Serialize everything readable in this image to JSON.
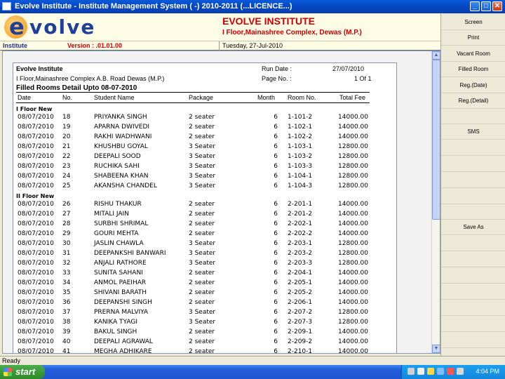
{
  "window": {
    "title": "Evolve Institute - Institute Management System ( -) 2010-2011 (...LICENCE...)"
  },
  "header": {
    "logo_text": "volve",
    "logo_letter": "e",
    "institute_name": "EVOLVE INSTITUTE",
    "institute_address": "I Floor,Mainashree Complex, Dewas (M.P.)"
  },
  "infobar": {
    "label": "Institute",
    "version": "Version : .01.01.00",
    "date": "Tuesday, 27-Jul-2010"
  },
  "right_menu": [
    "Screen",
    "Print",
    "Vacant Room",
    "Filled Room",
    "Reg.(Date)",
    "Reg.(Detail)",
    "SMS",
    "Save As"
  ],
  "report": {
    "org": "Evolve Institute",
    "address": "I Floor,Mainashree Complex A.B. Road Dewas (M.P.)",
    "title": "Filled Rooms Detail Upto 08-07-2010",
    "run_date_label": "Run Date :",
    "run_date": "27/07/2010",
    "page_label": "Page No. :",
    "page_value": "1 Of 1",
    "columns": [
      "Date",
      "No.",
      "Student Name",
      "Package",
      "Month",
      "Room No.",
      "Total Fee"
    ],
    "sections": [
      {
        "name": "I Floor New",
        "rows": [
          [
            "08/07/2010",
            "18",
            "PRIYANKA SINGH",
            "2 seater",
            "6",
            "1-101-2",
            "14000.00"
          ],
          [
            "08/07/2010",
            "19",
            "APARNA  DWIVEDI",
            "2 seater",
            "6",
            "1-102-1",
            "14000.00"
          ],
          [
            "08/07/2010",
            "20",
            "RAKHI WADHWANI",
            "2 seater",
            "6",
            "1-102-2",
            "14000.00"
          ],
          [
            "08/07/2010",
            "21",
            "KHUSHBU  GOYAL",
            "3 Seater",
            "6",
            "1-103-1",
            "12800.00"
          ],
          [
            "08/07/2010",
            "22",
            "DEEPALI  SOOD",
            "3 Seater",
            "6",
            "1-103-2",
            "12800.00"
          ],
          [
            "08/07/2010",
            "23",
            "RUCHIKA  SAHI",
            "3 Seater",
            "6",
            "1-103-3",
            "12800.00"
          ],
          [
            "08/07/2010",
            "24",
            "SHABEENA KHAN",
            "3 Seater",
            "6",
            "1-104-1",
            "12800.00"
          ],
          [
            "08/07/2010",
            "25",
            "AKANSHA CHANDEL",
            "3 Seater",
            "6",
            "1-104-3",
            "12800.00"
          ]
        ]
      },
      {
        "name": "II Floor New",
        "rows": [
          [
            "08/07/2010",
            "26",
            "RISHU  THAKUR",
            "2 seater",
            "6",
            "2-201-1",
            "14000.00"
          ],
          [
            "08/07/2010",
            "27",
            "MITALI  JAIN",
            "2 seater",
            "6",
            "2-201-2",
            "14000.00"
          ],
          [
            "08/07/2010",
            "28",
            "SURBHI  SHRIMAL",
            "2 seater",
            "6",
            "2-202-1",
            "14000.00"
          ],
          [
            "08/07/2010",
            "29",
            "GOURI  MEHTA",
            "2 seater",
            "6",
            "2-202-2",
            "14000.00"
          ],
          [
            "08/07/2010",
            "30",
            "JASLIN  CHAWLA",
            "3 Seater",
            "6",
            "2-203-1",
            "12800.00"
          ],
          [
            "08/07/2010",
            "31",
            "DEEPANKSHI  BANWARI",
            "3 Seater",
            "6",
            "2-203-2",
            "12800.00"
          ],
          [
            "08/07/2010",
            "32",
            "ANJALI  RATHORE",
            "3 Seater",
            "6",
            "2-203-3",
            "12800.00"
          ],
          [
            "08/07/2010",
            "33",
            "SUNITA  SAHANI",
            "2 seater",
            "6",
            "2-204-1",
            "14000.00"
          ],
          [
            "08/07/2010",
            "34",
            "ANMOL  PAEIHAR",
            "2 seater",
            "6",
            "2-205-1",
            "14000.00"
          ],
          [
            "08/07/2010",
            "35",
            "SHIVANI  BARATH",
            "2 seater",
            "6",
            "2-205-2",
            "14000.00"
          ],
          [
            "08/07/2010",
            "36",
            "DEEPANSHI  SINGH",
            "2 seater",
            "6",
            "2-206-1",
            "14000.00"
          ],
          [
            "08/07/2010",
            "37",
            "PRERNA  MALVIYA",
            "3 Seater",
            "6",
            "2-207-2",
            "12800.00"
          ],
          [
            "08/07/2010",
            "38",
            "KANIKA  TYAGI",
            "3 Seater",
            "6",
            "2-207-3",
            "12800.00"
          ],
          [
            "08/07/2010",
            "39",
            "BAKUL  SINGH",
            "2 seater",
            "6",
            "2-209-1",
            "14000.00"
          ],
          [
            "08/07/2010",
            "40",
            "DEEPALI  AGRAWAL",
            "2 seater",
            "6",
            "2-209-2",
            "14000.00"
          ],
          [
            "08/07/2010",
            "41",
            "MEGHA  ADHIKARE",
            "2 seater",
            "6",
            "2-210-1",
            "14000.00"
          ]
        ]
      }
    ]
  },
  "statusbar": {
    "text": "Ready"
  },
  "taskbar": {
    "start_label": "start",
    "clock": "4:04 PM"
  },
  "colors": {
    "title_accent": "#cc0000",
    "title_bar": "#0a5ad7",
    "start_green": "#3a9a37",
    "taskbar_blue": "#245edb"
  }
}
